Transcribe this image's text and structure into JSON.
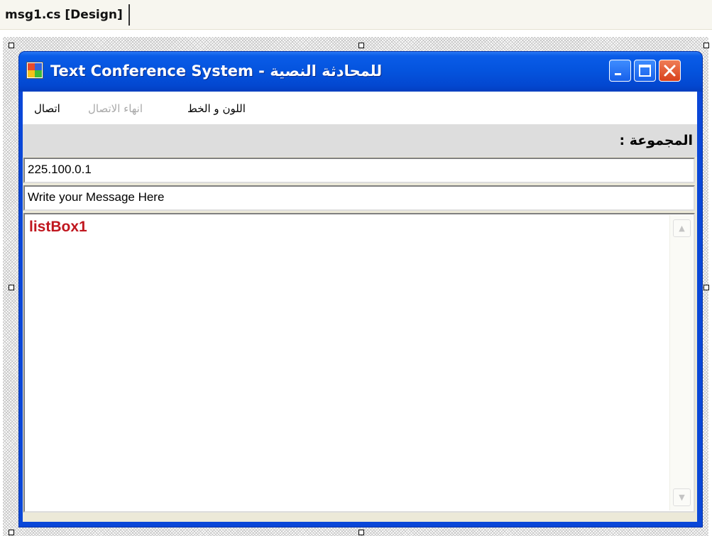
{
  "ide": {
    "tab_label": "msg1.cs [Design]"
  },
  "form": {
    "title_english": "Text Conference System - ",
    "title_arabic": "للمحادثة النصية",
    "buttons": {
      "minimize": "minimize",
      "maximize": "maximize",
      "close": "close"
    }
  },
  "menu": {
    "items": [
      {
        "label": "اتصال",
        "enabled": true
      },
      {
        "label": "انهاء الاتصال",
        "enabled": false
      },
      {
        "label": "اللون و الخط",
        "enabled": true
      }
    ]
  },
  "group": {
    "label": "المجموعة :"
  },
  "address_box": {
    "value": "225.100.0.1"
  },
  "message_box": {
    "value": "Write your Message Here"
  },
  "listbox": {
    "label": "listBox1",
    "scroll_up": "▲",
    "scroll_down": "▼"
  },
  "colors": {
    "title_bar": "#0453dd",
    "form_back": "#ece9d8",
    "group_back": "#dddddd",
    "listbox_label": "#c0161e"
  }
}
